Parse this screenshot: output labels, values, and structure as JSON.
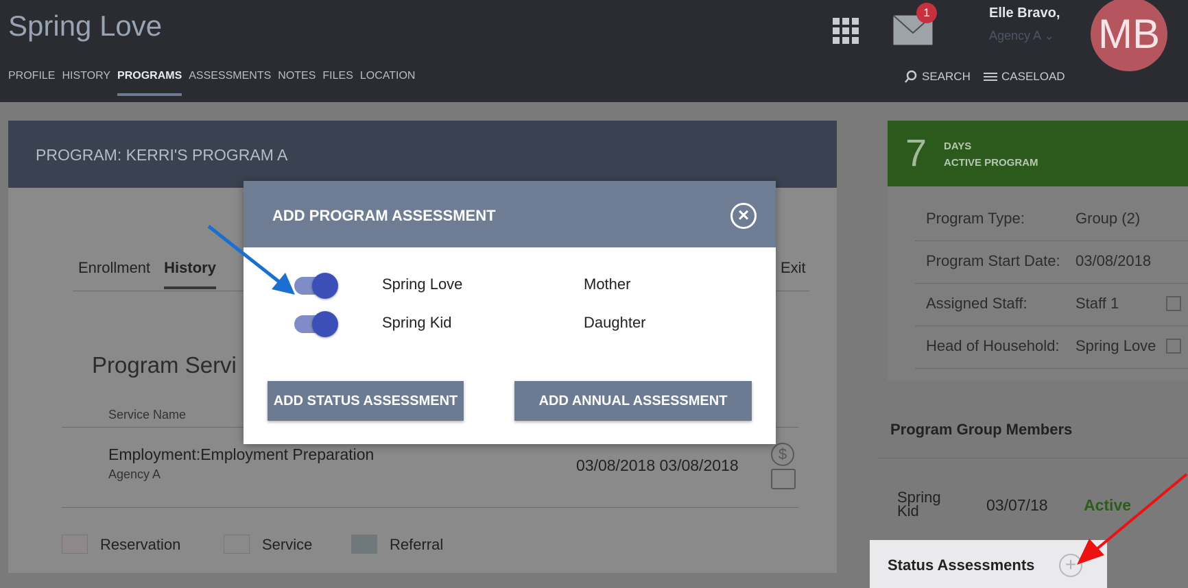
{
  "header": {
    "client_name": "Spring Love",
    "nav": [
      "PROFILE",
      "HISTORY",
      "PROGRAMS",
      "ASSESSMENTS",
      "NOTES",
      "FILES",
      "LOCATION"
    ],
    "active_nav": "PROGRAMS",
    "mail_count": "1",
    "user_name": "Elle Bravo,",
    "user_agency": "Agency A ⌄",
    "avatar_initials": "MB",
    "search_label": "SEARCH",
    "caseload_label": "CASELOAD"
  },
  "program": {
    "title": "PROGRAM: KERRI'S PROGRAM A",
    "tabs": [
      "Enrollment",
      "History"
    ],
    "active_tab": "History",
    "exit_tab": "Exit",
    "section_title": "Program Servi",
    "service_column": "Service Name",
    "services": [
      {
        "name": "Employment:Employment Preparation",
        "agency": "Agency A",
        "dates": "03/08/2018  03/08/2018"
      }
    ],
    "legend": [
      "Reservation",
      "Service",
      "Referral"
    ]
  },
  "sidebar": {
    "days": "7",
    "days_label_1": "DAYS",
    "days_label_2": "ACTIVE PROGRAM",
    "info": [
      {
        "label": "Program Type:",
        "value": "Group (2)"
      },
      {
        "label": "Program Start Date:",
        "value": "03/08/2018"
      },
      {
        "label": "Assigned Staff:",
        "value": "Staff 1"
      },
      {
        "label": "Head of Household:",
        "value": "Spring Love"
      }
    ],
    "members_title": "Program Group Members",
    "member": {
      "name": "Spring Kid",
      "date": "03/07/18",
      "status": "Active"
    },
    "status_assessments": "Status Assessments"
  },
  "modal": {
    "title": "ADD PROGRAM ASSESSMENT",
    "members": [
      {
        "name": "Spring Love",
        "role": "Mother",
        "enabled": true
      },
      {
        "name": "Spring Kid",
        "role": "Daughter",
        "enabled": true
      }
    ],
    "btn_status": "ADD STATUS ASSESSMENT",
    "btn_annual": "ADD ANNUAL ASSESSMENT"
  },
  "colors": {
    "header_bg": "#2a2c32",
    "modal_header": "#6e7d94",
    "toggle_on": "#3c4fb8",
    "active_green": "#2b5a1c",
    "arrow_blue": "#1a6fd1",
    "arrow_red": "#ee1111"
  }
}
